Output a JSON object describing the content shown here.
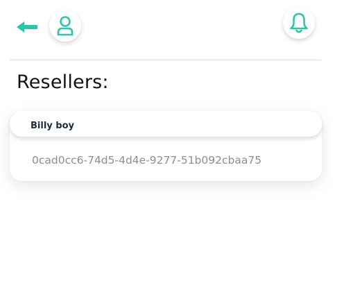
{
  "header": {
    "back_icon": "arrow-left-icon",
    "profile_icon": "user-icon",
    "notification_icon": "bell-icon",
    "accent_color": "#2ec4a9"
  },
  "page": {
    "title": "Resellers:"
  },
  "resellers": [
    {
      "name": "Billy boy",
      "id": "0cad0cc6-74d5-4d4e-9277-51b092cbaa75"
    }
  ]
}
